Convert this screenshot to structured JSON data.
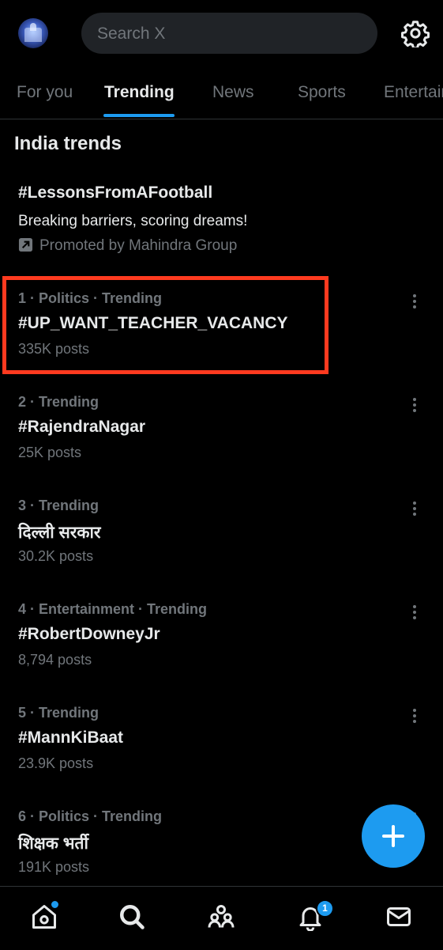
{
  "search": {
    "placeholder": "Search X"
  },
  "tabs": [
    {
      "label": "For you"
    },
    {
      "label": "Trending"
    },
    {
      "label": "News"
    },
    {
      "label": "Sports"
    },
    {
      "label": "Entertainment"
    }
  ],
  "section_title": "India trends",
  "promoted": {
    "hashtag": "#LessonsFromAFootball",
    "description": "Breaking barriers, scoring dreams!",
    "by": "Promoted by Mahindra Group"
  },
  "trends": [
    {
      "meta": "1 · Politics · Trending",
      "name": "#UP_WANT_TEACHER_VACANCY",
      "posts": "335K posts"
    },
    {
      "meta": "2 · Trending",
      "name": "#RajendraNagar",
      "posts": "25K posts"
    },
    {
      "meta": "3 · Trending",
      "name": "दिल्ली सरकार",
      "posts": "30.2K posts"
    },
    {
      "meta": "4 · Entertainment · Trending",
      "name": "#RobertDowneyJr",
      "posts": "8,794 posts"
    },
    {
      "meta": "5 · Trending",
      "name": "#MannKiBaat",
      "posts": "23.9K posts"
    },
    {
      "meta": "6 · Politics · Trending",
      "name": "शिक्षक भर्ती",
      "posts": "191K posts"
    }
  ],
  "notifications_badge": "1",
  "colors": {
    "accent": "#1d9bf0",
    "highlight": "#ff3a1f",
    "background": "#000000",
    "muted": "#71767b"
  }
}
